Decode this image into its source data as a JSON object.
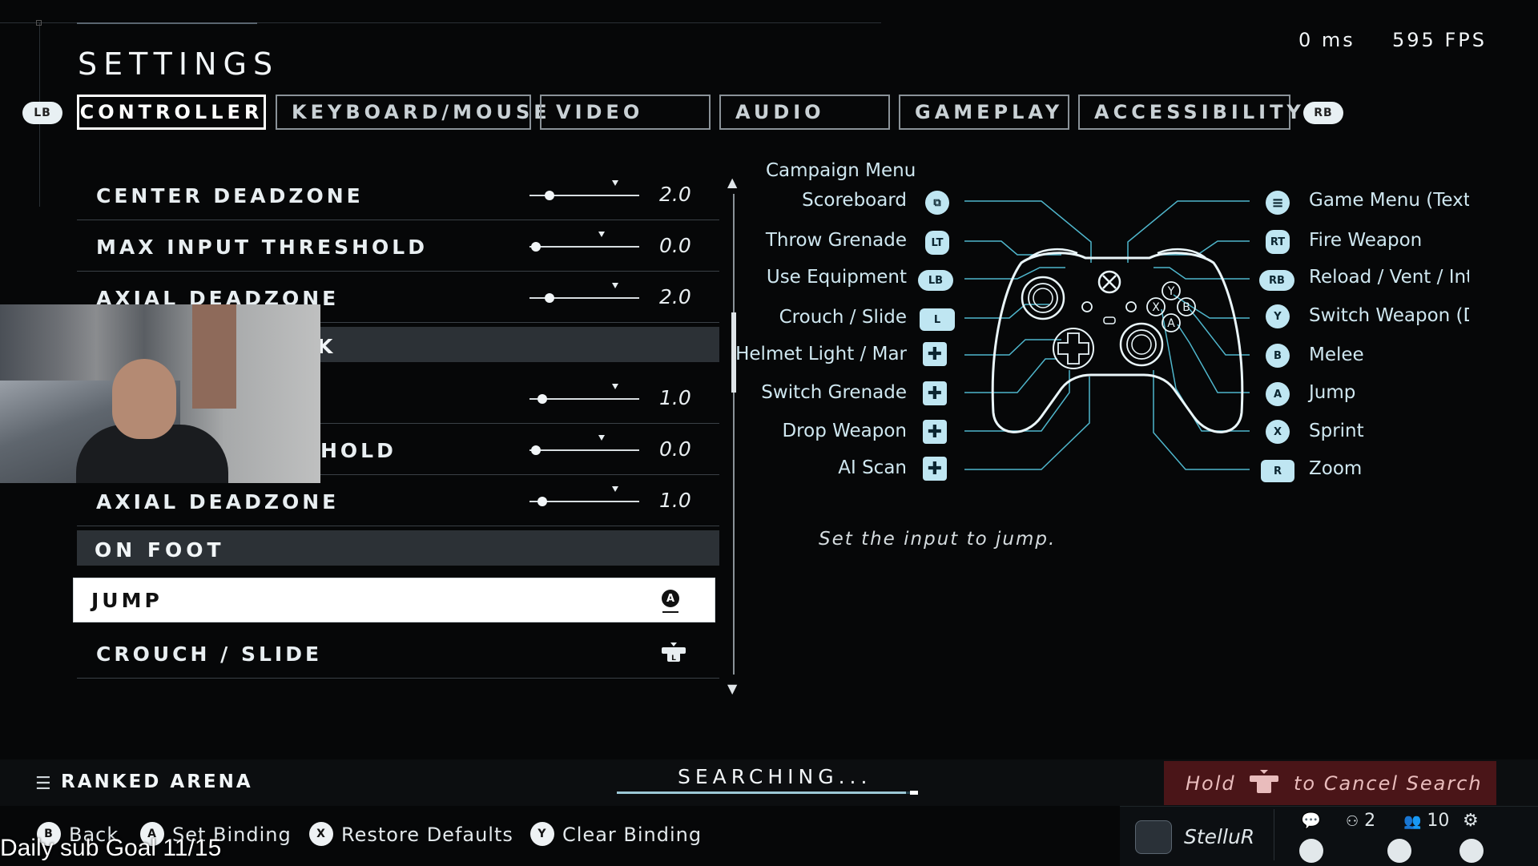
{
  "header": {
    "title": "SETTINGS",
    "latency": "0 ms",
    "fps": "595 FPS"
  },
  "tabs": {
    "lb": "LB",
    "rb": "RB",
    "items": [
      "CONTROLLER",
      "KEYBOARD/MOUSE",
      "VIDEO",
      "AUDIO",
      "GAMEPLAY",
      "ACCESSIBILITY"
    ],
    "active": "CONTROLLER"
  },
  "settings": {
    "rows": [
      {
        "label": "CENTER DEADZONE",
        "value": "2.0",
        "fraction": 0.18,
        "default_fraction": 0.78
      },
      {
        "label": "MAX INPUT THRESHOLD",
        "value": "0.0",
        "fraction": 0.06,
        "default_fraction": 0.66
      },
      {
        "label": "AXIAL DEADZONE",
        "value": "2.0",
        "fraction": 0.18,
        "default_fraction": 0.78
      },
      {
        "label": "K"
      },
      {
        "label": "",
        "value": "1.0",
        "fraction": 0.12,
        "default_fraction": 0.78
      },
      {
        "label": "HOLD",
        "value": "0.0",
        "fraction": 0.06,
        "default_fraction": 0.66
      },
      {
        "label": "AXIAL DEADZONE",
        "value": "1.0",
        "fraction": 0.12,
        "default_fraction": 0.78
      }
    ],
    "section_on_foot": "ON FOOT",
    "jump": {
      "label": "JUMP",
      "button": "A"
    },
    "crouch": {
      "label": "CROUCH / SLIDE"
    }
  },
  "diagram": {
    "campaign_menu": "Campaign Menu",
    "left": [
      {
        "label": "Scoreboard",
        "badge": "⧉"
      },
      {
        "label": "Throw Grenade",
        "badge": "LT"
      },
      {
        "label": "Use Equipment",
        "badge": "LB"
      },
      {
        "label": "Crouch / Slide",
        "badge": "L"
      },
      {
        "label": "Helmet Light / Mar",
        "badge": "✚"
      },
      {
        "label": "Switch Grenade",
        "badge": "✚"
      },
      {
        "label": "Drop Weapon",
        "badge": "✚"
      },
      {
        "label": "AI Scan",
        "badge": "✚"
      }
    ],
    "right": [
      {
        "label": "Game Menu (Text ",
        "badge": "≡"
      },
      {
        "label": "Fire Weapon",
        "badge": "RT"
      },
      {
        "label": "Reload / Vent / Int",
        "badge": "RB"
      },
      {
        "label": "Switch Weapon (Dr",
        "badge": "Y"
      },
      {
        "label": "Melee",
        "badge": "B"
      },
      {
        "label": "Jump",
        "badge": "A"
      },
      {
        "label": "Sprint",
        "badge": "X"
      },
      {
        "label": "Zoom",
        "badge": "R"
      }
    ],
    "description": "Set the input to jump.",
    "controller_buttons": {
      "y": "Y",
      "x": "X",
      "b": "B",
      "a": "A"
    }
  },
  "bottom": {
    "playlist": "RANKED ARENA",
    "searching": "SEARCHING...",
    "search_progress": 0.96,
    "cancel_hold": "Hold",
    "cancel_rest": "to Cancel Search",
    "hints": [
      {
        "btn": "B",
        "label": "Back"
      },
      {
        "btn": "A",
        "label": "Set Binding"
      },
      {
        "btn": "X",
        "label": "Restore Defaults"
      },
      {
        "btn": "Y",
        "label": "Clear Binding"
      }
    ],
    "username": "StelluR",
    "fireteam": "2",
    "friends": "10"
  },
  "overlay": {
    "sub_goal": "Daily sub Goal 11/15"
  },
  "colors": {
    "accent": "#bfe6f2",
    "diagram_line": "#4fb6cc",
    "cancel_bg": "#4a1518"
  }
}
